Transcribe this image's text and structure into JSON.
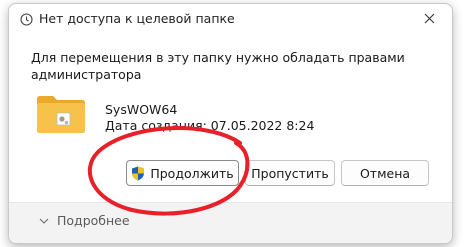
{
  "dialog": {
    "title": "Нет доступа к целевой папке",
    "message": "Для перемещения в эту папку нужно обладать правами администратора",
    "item": {
      "name": "SysWOW64",
      "date_created": "Дата создания: 07.05.2022 8:24"
    },
    "buttons": {
      "continue": "Продолжить",
      "skip": "Пропустить",
      "cancel": "Отмена"
    },
    "more_details": "Подробнее"
  },
  "colors": {
    "annotation": "#e8202a",
    "folder": "#f6c24a",
    "accent": "#0067c0"
  },
  "icons": [
    "folder-move-icon",
    "close-icon",
    "folder-icon",
    "uac-shield-icon",
    "chevron-down-icon"
  ]
}
